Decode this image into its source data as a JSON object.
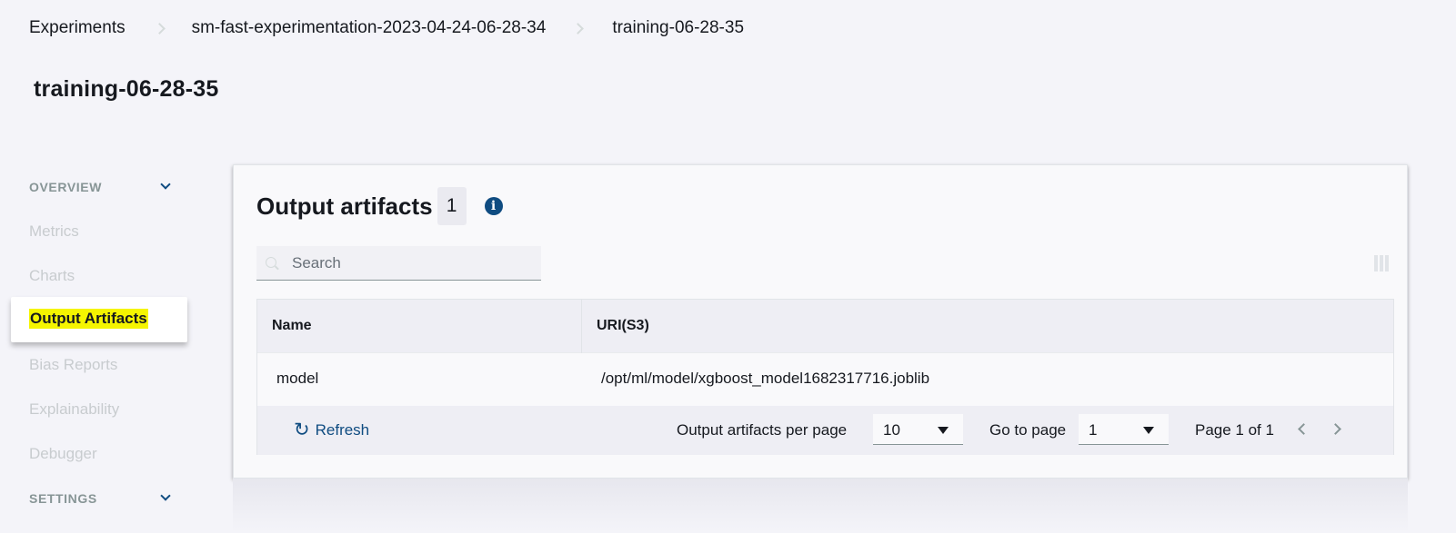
{
  "breadcrumb": {
    "items": [
      "Experiments",
      "sm-fast-experimentation-2023-04-24-06-28-34",
      "training-06-28-35"
    ]
  },
  "page": {
    "title": "training-06-28-35"
  },
  "sidebar": {
    "overview_label": "OVERVIEW",
    "settings_label": "SETTINGS",
    "items": [
      "Metrics",
      "Charts",
      "Output Artifacts",
      "Bias Reports",
      "Explainability",
      "Debugger"
    ],
    "active_item": "Output Artifacts"
  },
  "panel": {
    "title": "Output artifacts",
    "count": "1",
    "search_placeholder": "Search",
    "columns": [
      "Name",
      "URI(S3)"
    ],
    "rows": [
      {
        "name": "model",
        "uri": "/opt/ml/model/xgboost_model1682317716.joblib"
      }
    ],
    "footer": {
      "refresh_label": "Refresh",
      "per_page_label": "Output artifacts per page",
      "per_page_value": "10",
      "goto_label": "Go to page",
      "goto_value": "1",
      "page_label": "Page 1 of 1"
    }
  },
  "colors": {
    "accent": "#0f4c81",
    "highlight": "#f5f500",
    "background": "#f4f4f9"
  }
}
